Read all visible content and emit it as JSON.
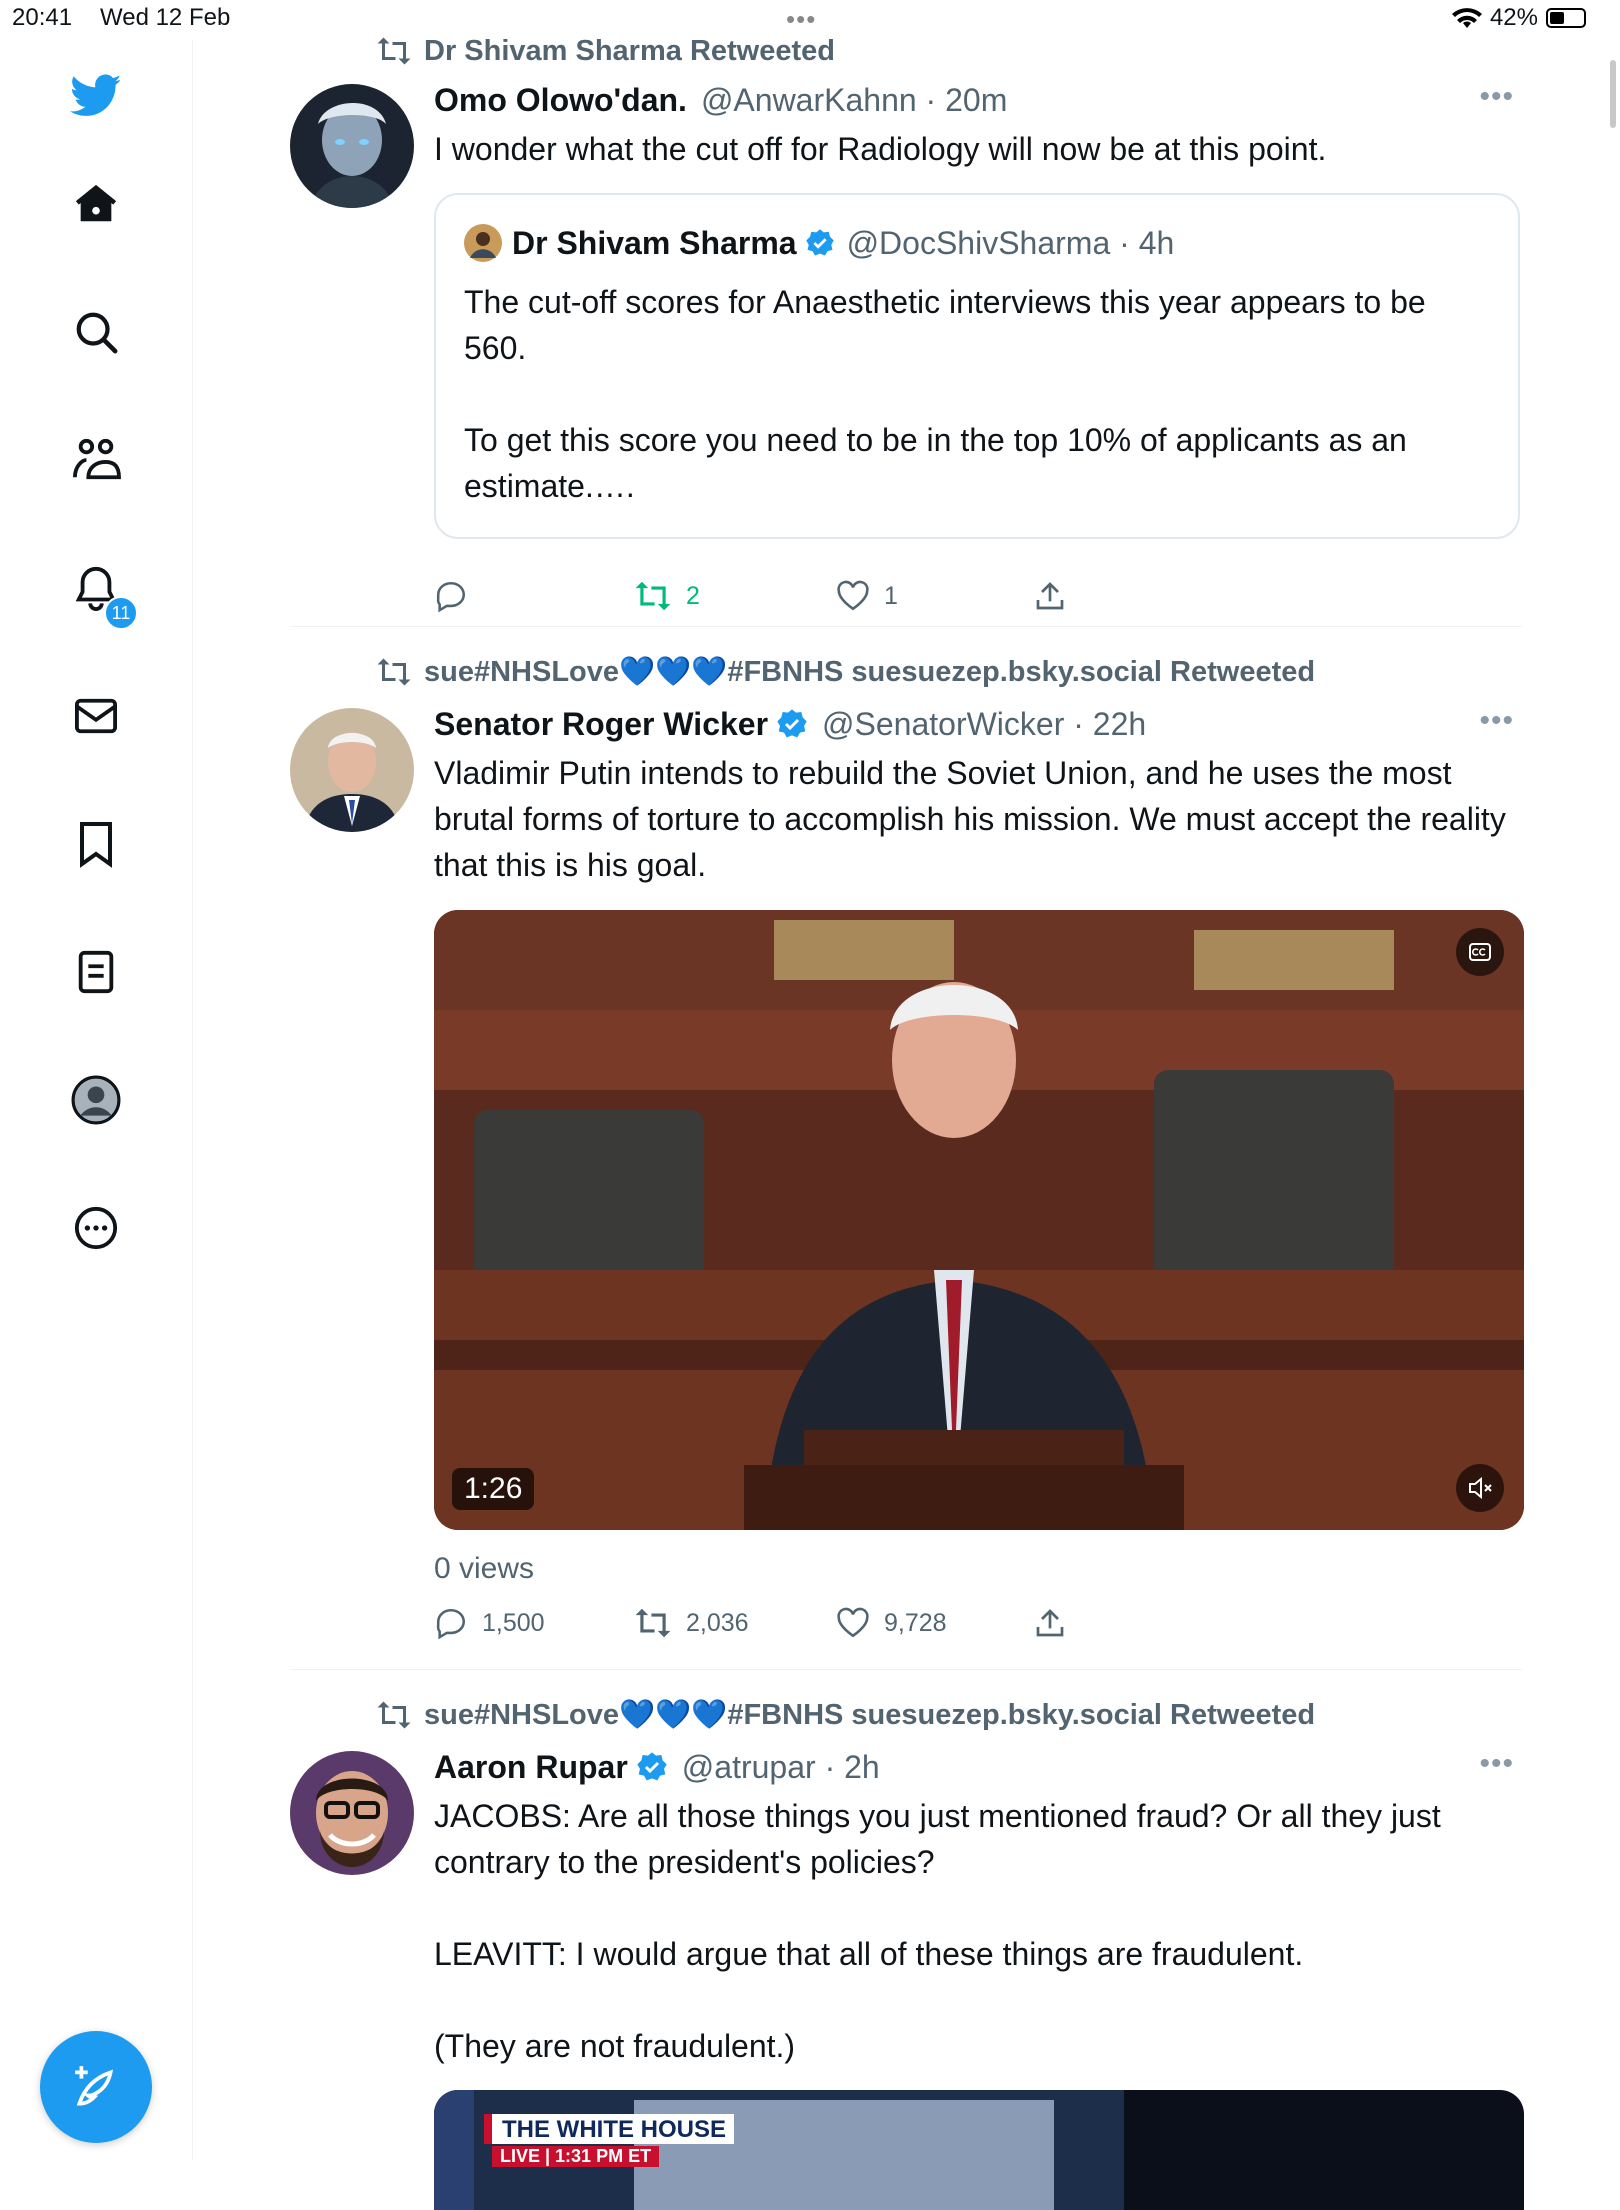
{
  "status_bar": {
    "time": "20:41",
    "date": "Wed 12 Feb",
    "battery": "42%"
  },
  "sidebar": {
    "items": [
      "home-icon",
      "search-icon",
      "communities-icon",
      "notifications-icon",
      "messages-icon",
      "bookmarks-icon",
      "lists-icon",
      "profile-icon",
      "more-icon"
    ],
    "notification_count": "11"
  },
  "tweets": [
    {
      "retweeted_by": "Dr Shivam Sharma Retweeted",
      "name": "Omo Olowo'dan.",
      "handle": "@AnwarKahnn · 20m",
      "text": "I wonder what the cut off for Radiology will now be at this point.",
      "quote": {
        "name": "Dr Shivam Sharma",
        "handle": "@DocShivSharma · 4h",
        "text": "The cut-off scores for Anaesthetic interviews this year appears to be 560.\n\nTo get this score you need to be in the top 10% of applicants as an estimate.…."
      },
      "replies": "",
      "retweets": "2",
      "likes": "1"
    },
    {
      "retweeted_by": "sue#NHSLove💙💙💙#FBNHS suesuezep.bsky.social Retweeted",
      "name": "Senator Roger Wicker",
      "handle": "@SenatorWicker · 22h",
      "text": "Vladimir Putin intends to rebuild the Soviet Union, and he uses the most brutal forms of torture to accomplish his mission. We must accept the reality that this is his goal.",
      "video_duration": "1:26",
      "views": "0 views",
      "replies": "1,500",
      "retweets": "2,036",
      "likes": "9,728"
    },
    {
      "retweeted_by": "sue#NHSLove💙💙💙#FBNHS suesuezep.bsky.social Retweeted",
      "name": "Aaron Rupar",
      "handle": "@atrupar · 2h",
      "text": "JACOBS: Are all those things you just mentioned fraud? Or all they just contrary to the president's policies?\n\nLEAVITT: I would argue that all of these things are fraudulent.\n\n(They are not fraudulent.)",
      "media_banner": "THE WHITE HOUSE",
      "media_live": "LIVE | 1:31 PM ET"
    }
  ],
  "colors": {
    "accent": "#1d9bf0",
    "retweet_green": "#00ba7c",
    "muted": "#536471"
  }
}
